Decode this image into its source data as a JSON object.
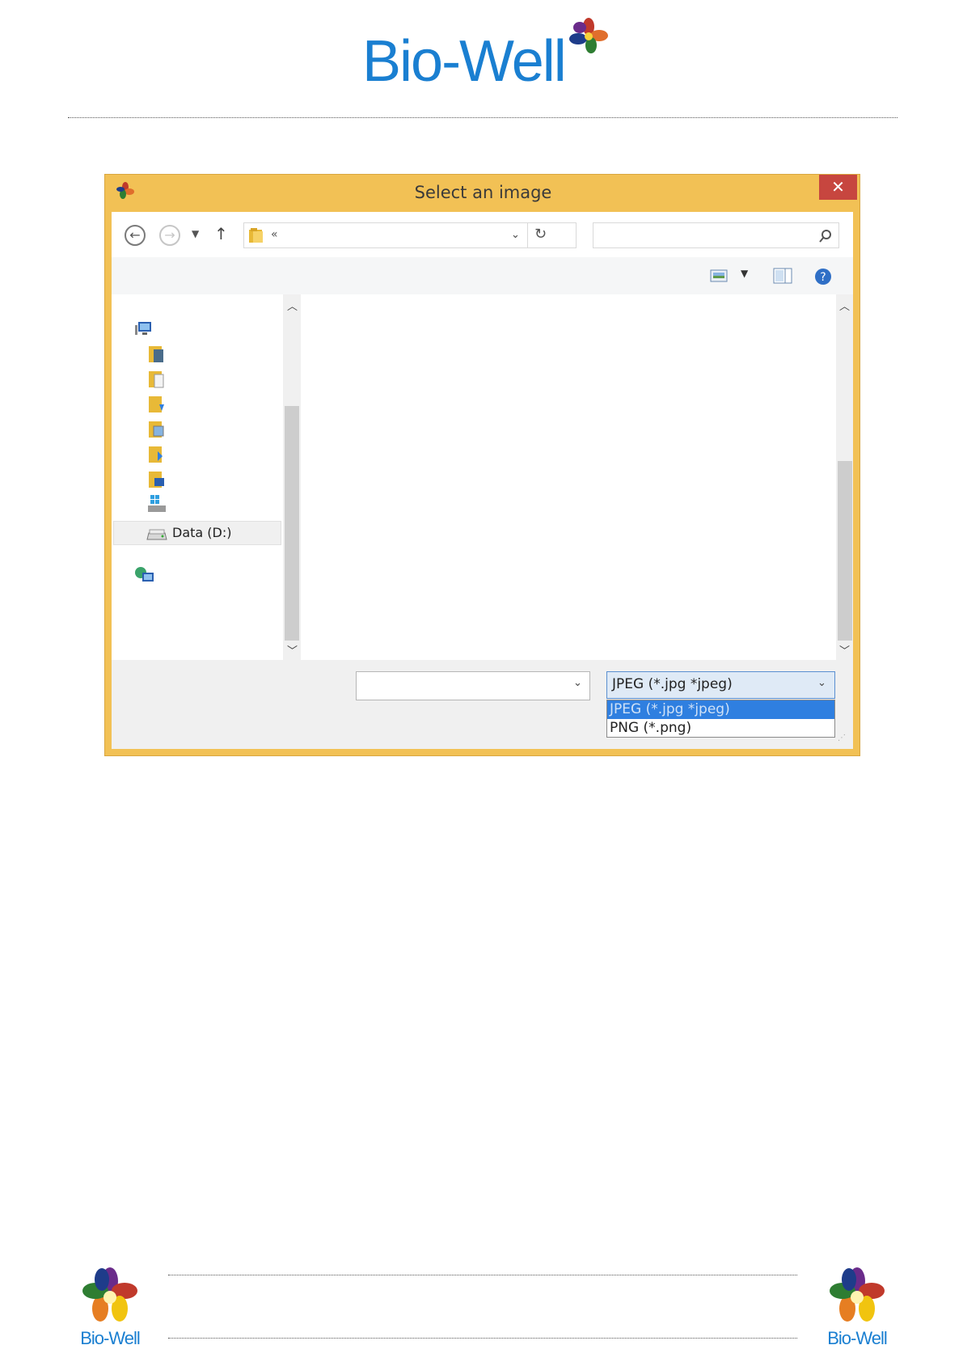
{
  "brand": {
    "name": "Bio-Well"
  },
  "dialog": {
    "title": "Select an image",
    "close_label": "✕",
    "address": {
      "chevrons": "«"
    },
    "search": {
      "placeholder": ""
    },
    "nav_items": [
      {
        "icon": "computer-icon",
        "label": ""
      },
      {
        "icon": "videos-folder-icon",
        "label": ""
      },
      {
        "icon": "documents-folder-icon",
        "label": ""
      },
      {
        "icon": "downloads-folder-icon",
        "label": ""
      },
      {
        "icon": "pictures-folder-icon",
        "label": ""
      },
      {
        "icon": "music-folder-icon",
        "label": ""
      },
      {
        "icon": "desktop-folder-icon",
        "label": ""
      },
      {
        "icon": "windows-drive-icon",
        "label": ""
      },
      {
        "icon": "data-drive-icon",
        "label": "Data (D:)"
      },
      {
        "icon": "network-icon",
        "label": ""
      }
    ],
    "file_name": {
      "value": ""
    },
    "file_type": {
      "selected": "JPEG (*.jpg *jpeg)",
      "options": [
        "JPEG (*.jpg *jpeg)",
        "PNG (*.png)"
      ]
    }
  },
  "colors": {
    "frame": "#f2c155",
    "close": "#c7463f",
    "selection": "#2f7fe0",
    "brand_blue": "#1a7fd1"
  }
}
